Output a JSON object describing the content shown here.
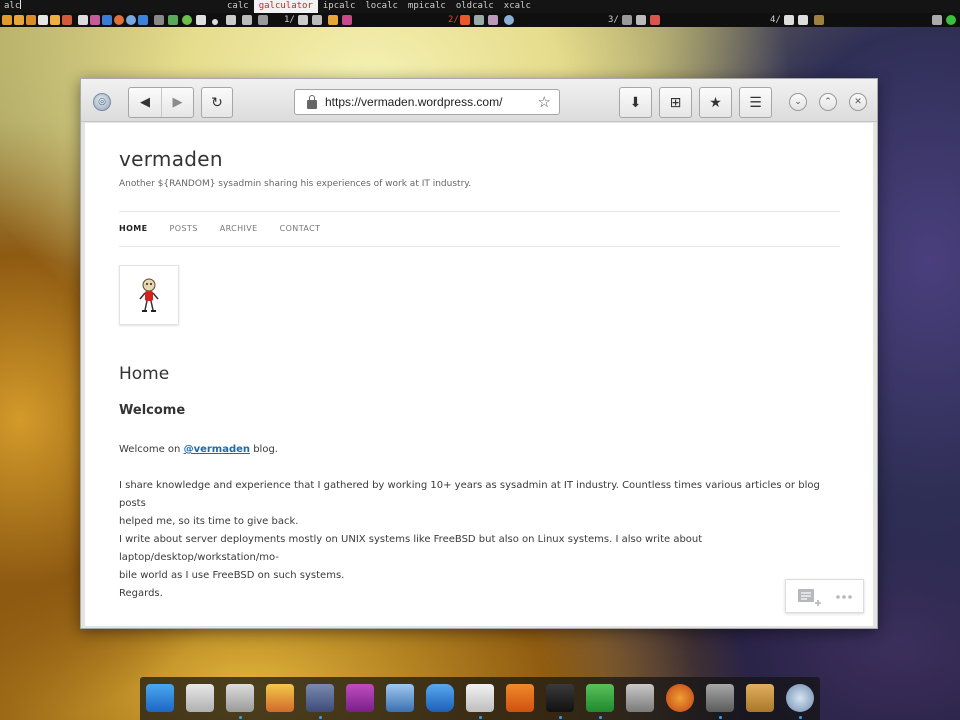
{
  "topbar": {
    "prompt_text": "alc",
    "launcher_items": [
      "calc",
      "galculator",
      "ipcalc",
      "localc",
      "mpicalc",
      "oldcalc",
      "xcalc"
    ],
    "selected_launcher_item": "galculator",
    "workspaces": [
      "1/",
      "2/",
      "3/",
      "4/"
    ],
    "active_workspace": "2/"
  },
  "browser": {
    "url": "https://vermaden.wordpress.com/",
    "site_title": "vermaden",
    "tagline": "Another ${RANDOM} sysadmin sharing his experiences of work at IT industry.",
    "menu": [
      "HOME",
      "POSTS",
      "ARCHIVE",
      "CONTACT"
    ],
    "active_menu": "HOME",
    "page_heading": "Home",
    "sub_heading": "Welcome",
    "para1_prefix": "Welcome on ",
    "para1_link": "@vermaden",
    "para1_suffix": " blog.",
    "para2_line1": "I share knowledge and experience that I gathered by working 10+ years as sysadmin at IT industry. Countless times various articles or blog posts",
    "para2_line2": "helped me, so its time to give back.",
    "para3_line1": "I write about server deployments mostly on UNIX systems like FreeBSD but also on Linux systems. I also write about laptop/desktop/workstation/mo-",
    "para3_line2": "bile world as I use FreeBSD on such systems.",
    "para4": "Regards."
  },
  "icons": {
    "back": "arrow-left-icon",
    "forward": "arrow-right-icon",
    "reload": "reload-icon",
    "star": "bookmark-star-icon",
    "download": "download-icon",
    "new_tab": "new-tab-icon",
    "library": "library-icon",
    "menu": "hamburger-menu-icon",
    "minimize": "chevron-down-icon",
    "maximize": "chevron-up-icon",
    "close": "close-icon"
  },
  "colors": {
    "link": "#1e6aa6",
    "launcher_selected": "#d8201c",
    "dock_indicator": "#3aa0f0"
  }
}
